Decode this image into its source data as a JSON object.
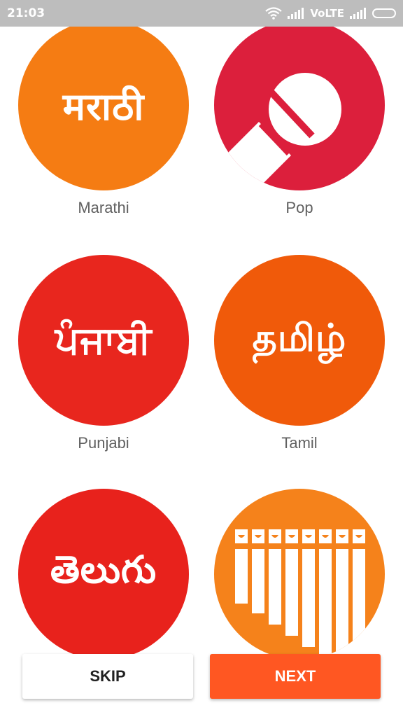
{
  "status_bar": {
    "time": "21:03",
    "network_label": "VoLTE",
    "icons": [
      "wifi-icon",
      "signal-icon",
      "signal-icon",
      "battery-icon"
    ]
  },
  "tiles": [
    {
      "script": "मराठी",
      "caption": "Marathi",
      "color": "#f57c13",
      "icon": "script-text"
    },
    {
      "script": "",
      "caption": "Pop",
      "color": "#dc1f3c",
      "icon": "microphone-icon"
    },
    {
      "script": "ਪੰਜਾਬੀ",
      "caption": "Punjabi",
      "color": "#e8261e",
      "icon": "script-text"
    },
    {
      "script": "தமிழ்",
      "caption": "Tamil",
      "color": "#f05a0a",
      "icon": "script-text"
    },
    {
      "script": "తెలుగు",
      "caption": "",
      "color": "#e8221c",
      "icon": "script-text"
    },
    {
      "script": "",
      "caption": "",
      "color": "#f5821b",
      "icon": "xylophone-icon"
    }
  ],
  "buttons": {
    "skip": "SKIP",
    "next": "NEXT"
  },
  "colors": {
    "status_bar": "#bdbdbd",
    "accent": "#ff5722",
    "caption_text": "#616161"
  }
}
